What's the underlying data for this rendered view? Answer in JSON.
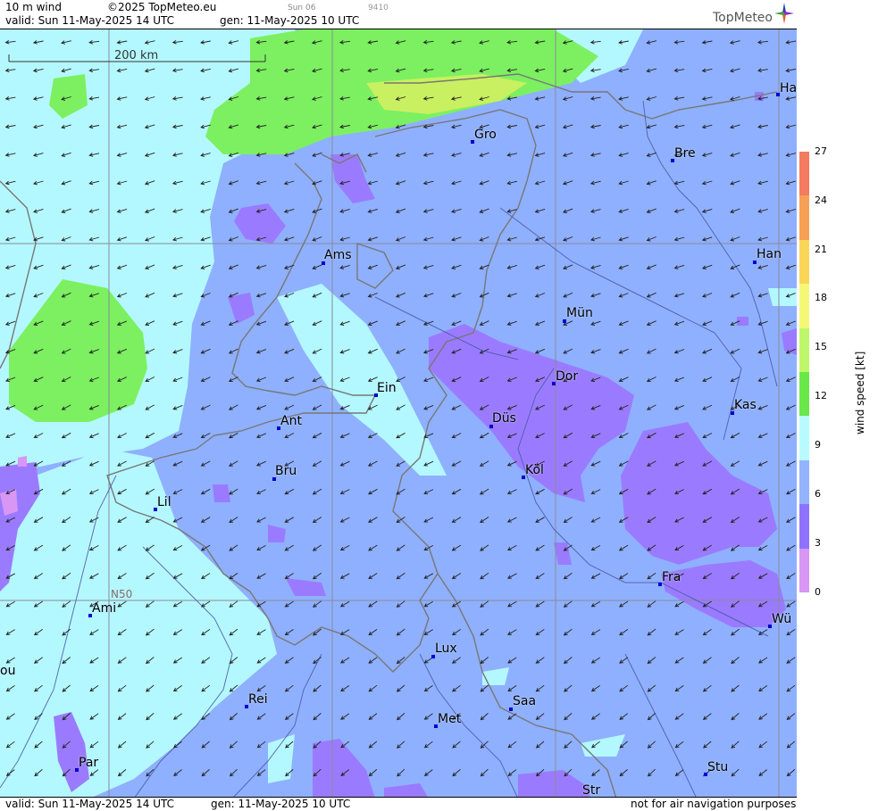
{
  "header": {
    "product": "10 m wind",
    "copyright": "©2025 TopMeteo.eu",
    "small_day": "Sun 06",
    "small_code": "9410",
    "valid": "valid:  Sun  11-May-2025  14 UTC",
    "gen": "gen: 11-May-2025 10 UTC",
    "logo": "TopMeteo"
  },
  "footer": {
    "valid": "valid:  Sun  11-May-2025  14 UTC",
    "gen": "gen: 11-May-2025 10 UTC",
    "notice": "not for air navigation purposes"
  },
  "map": {
    "scale_label": "200 km",
    "grid_label": "N50",
    "cities": [
      {
        "name": "Ha"
      },
      {
        "name": "Gro"
      },
      {
        "name": "Bre"
      },
      {
        "name": "Ams"
      },
      {
        "name": "Han"
      },
      {
        "name": "Mün"
      },
      {
        "name": "Dor"
      },
      {
        "name": "Ein"
      },
      {
        "name": "Kas"
      },
      {
        "name": "Düs"
      },
      {
        "name": "Ant"
      },
      {
        "name": "Köl"
      },
      {
        "name": "Bru"
      },
      {
        "name": "Lil"
      },
      {
        "name": "Fra"
      },
      {
        "name": "Ami"
      },
      {
        "name": "Wü"
      },
      {
        "name": "Lux"
      },
      {
        "name": "ou"
      },
      {
        "name": "Rei"
      },
      {
        "name": "Saa"
      },
      {
        "name": "Met"
      },
      {
        "name": "Par"
      },
      {
        "name": "Stu"
      },
      {
        "name": "Str"
      }
    ],
    "colors": {
      "bg_blue": "#8fb0ff",
      "cyan": "#b4f8ff",
      "purple": "#9a7bff",
      "green": "#7cf060",
      "yellowgreen": "#c8f060",
      "border": "#777777",
      "river": "#4a5aa8"
    }
  },
  "legend": {
    "title": "wind speed [kt]",
    "ticks": [
      "27",
      "24",
      "21",
      "18",
      "15",
      "12",
      "9",
      "6",
      "3",
      "0"
    ],
    "colors": [
      "#f47a60",
      "#f6a055",
      "#fbd558",
      "#f5f777",
      "#bff76a",
      "#69e84a",
      "#b8fbff",
      "#93b3ff",
      "#8e72ff",
      "#d896f5"
    ]
  }
}
